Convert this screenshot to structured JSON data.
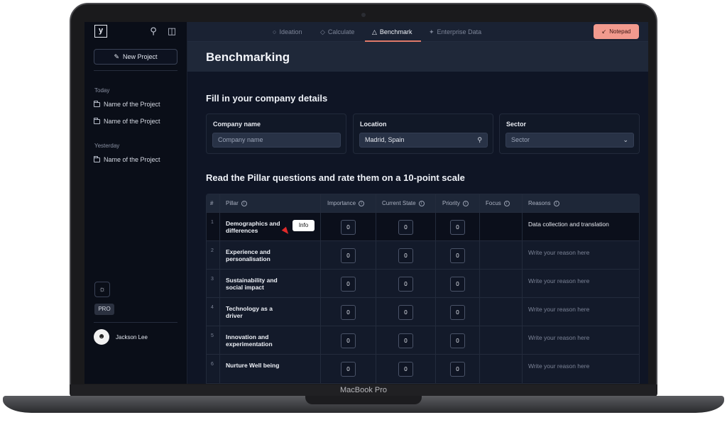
{
  "device": {
    "label": "MacBook Pro"
  },
  "sidebar": {
    "logo": "y",
    "new_project_label": "New Project",
    "sections": [
      {
        "title": "Today",
        "items": [
          "Name of the Project",
          "Name of the Project"
        ]
      },
      {
        "title": "Yesterday",
        "items": [
          "Name of the Project"
        ]
      }
    ],
    "theme_icon": "sun-icon",
    "badge": "PRO",
    "user": {
      "name": "Jackson Lee"
    }
  },
  "topbar": {
    "tabs": [
      {
        "label": "Ideation",
        "icon": "bulb-icon",
        "active": false
      },
      {
        "label": "Calculate",
        "icon": "diamond-icon",
        "active": false
      },
      {
        "label": "Benchmark",
        "icon": "flame-icon",
        "active": true
      },
      {
        "label": "Enterprise Data",
        "icon": "sparkle-icon",
        "active": false
      }
    ],
    "notepad_label": "Notepad"
  },
  "page": {
    "title": "Benchmarking",
    "details_title": "Fill in your company details",
    "company": {
      "label": "Company name",
      "placeholder": "Company name"
    },
    "location": {
      "label": "Location",
      "value": "Madrid, Spain"
    },
    "sector": {
      "label": "Sector",
      "placeholder": "Sector"
    },
    "table_title": "Read the Pillar questions and rate them on a 10-point scale"
  },
  "table": {
    "headers": [
      "#",
      "Pillar",
      "Importance",
      "Current State",
      "Priority",
      "Focus",
      "Reasons"
    ],
    "info_label": "Info",
    "rows": [
      {
        "num": "1",
        "pillar": "Demographics and differences",
        "importance": "0",
        "current": "0",
        "priority": "0",
        "reason": "Data collection and translation"
      },
      {
        "num": "2",
        "pillar": "Experience and personalisation",
        "importance": "0",
        "current": "0",
        "priority": "0",
        "reason": "Write your reason here"
      },
      {
        "num": "3",
        "pillar": "Sustainability and social impact",
        "importance": "0",
        "current": "0",
        "priority": "0",
        "reason": "Write your reason here"
      },
      {
        "num": "4",
        "pillar": "Technology as a driver",
        "importance": "0",
        "current": "0",
        "priority": "0",
        "reason": "Write your reason here"
      },
      {
        "num": "5",
        "pillar": "Innovation and experimentation",
        "importance": "0",
        "current": "0",
        "priority": "0",
        "reason": "Write your reason here"
      },
      {
        "num": "6",
        "pillar": "Nurture Well being",
        "importance": "0",
        "current": "0",
        "priority": "0",
        "reason": "Write your reason here"
      }
    ]
  }
}
